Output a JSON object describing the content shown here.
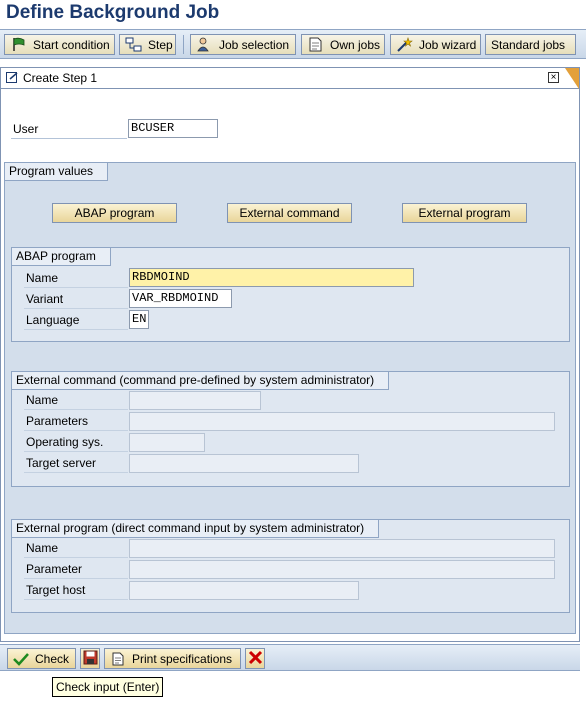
{
  "window": {
    "title": "Define Background Job"
  },
  "toolbar": {
    "start_condition": "Start condition",
    "step": "Step",
    "job_selection": "Job selection",
    "own_jobs": "Own jobs",
    "job_wizard": "Job wizard",
    "standard_jobs": "Standard jobs"
  },
  "screen": {
    "title": "Create Step  1"
  },
  "user": {
    "label": "User",
    "value": "BCUSER"
  },
  "program_values": {
    "title": "Program values",
    "abap_button": "ABAP program",
    "external_command_button": "External command",
    "external_program_button": "External program"
  },
  "abap_program": {
    "title": "ABAP program",
    "name_label": "Name",
    "name_value": "RBDMOIND",
    "variant_label": "Variant",
    "variant_value": "VAR_RBDMOIND",
    "language_label": "Language",
    "language_value": "EN"
  },
  "external_command": {
    "title": "External command (command pre-defined by system administrator)",
    "name_label": "Name",
    "parameters_label": "Parameters",
    "os_label": "Operating sys.",
    "target_server_label": "Target server"
  },
  "external_program": {
    "title": "External program (direct command input by system administrator)",
    "name_label": "Name",
    "parameter_label": "Parameter",
    "target_host_label": "Target host"
  },
  "footer": {
    "check": "Check",
    "print_specifications": "Print specifications"
  },
  "tooltip": {
    "text": "Check input   (Enter)"
  },
  "colors": {
    "title": "#1c3a6e",
    "required_field": "#fff2a8",
    "group_bg": "#d3deeb",
    "cancel": "#cc0000"
  }
}
